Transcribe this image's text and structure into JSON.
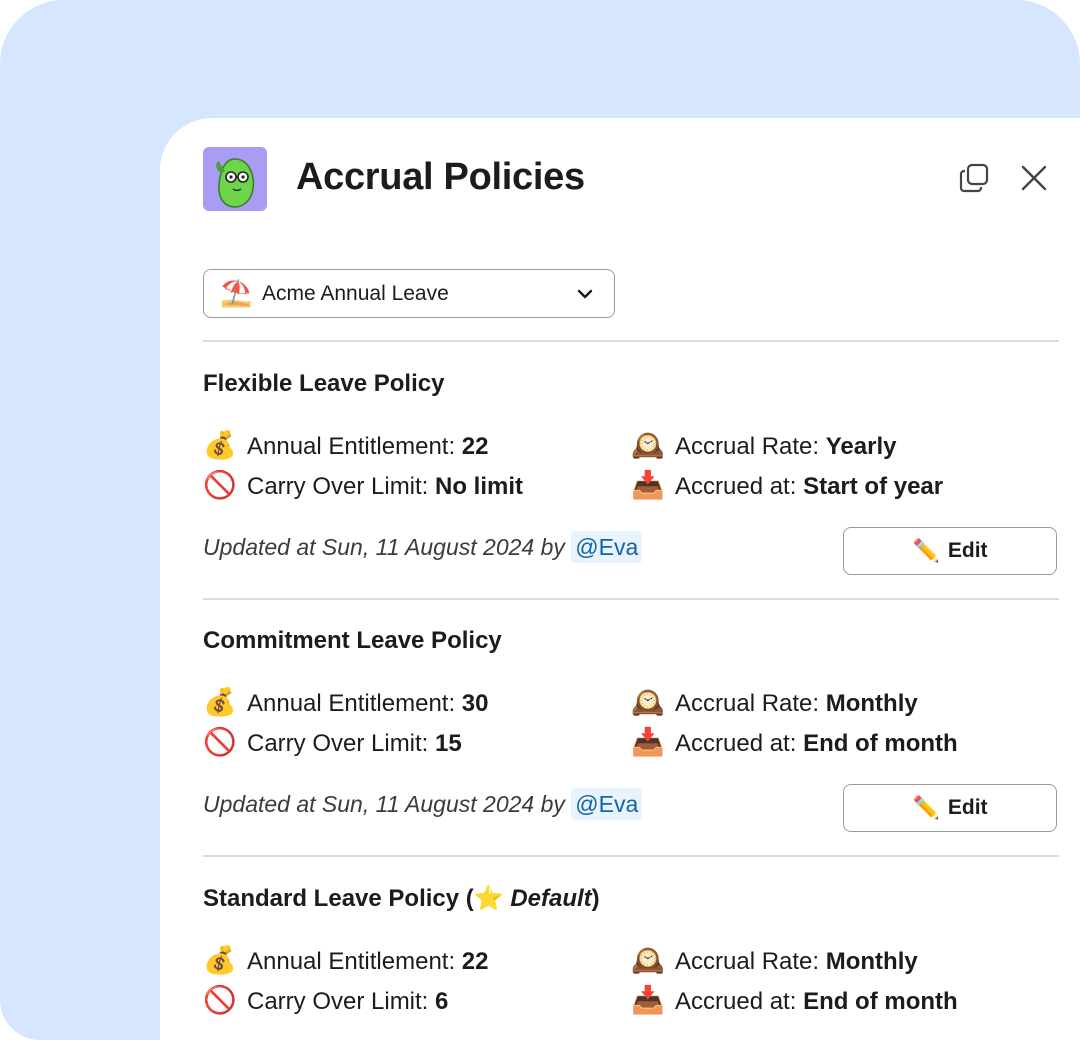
{
  "modal": {
    "title": "Accrual Policies",
    "avatar_icon": "bird-with-glasses-icon",
    "copy_icon": "copy-icon",
    "close_icon": "close-icon"
  },
  "policy_select": {
    "emoji": "⛱️",
    "selected": "Acme Annual Leave"
  },
  "labels": {
    "entitlement": "Annual Entitlement: ",
    "carry": "Carry Over Limit: ",
    "rate": "Accrual Rate: ",
    "accrued": "Accrued at: ",
    "updated_prefix": "Updated at ",
    "by": " by ",
    "edit": "Edit"
  },
  "icons": {
    "money_bag": "💰",
    "no_entry": "🚫",
    "clock": "🕰️",
    "inbox": "📥",
    "pencil": "✏️",
    "star": "⭐"
  },
  "policies": [
    {
      "name": "Flexible Leave Policy",
      "entitlement": "22",
      "carry_over": "No limit",
      "accrual_rate": "Yearly",
      "accrued_at": "Start of year",
      "updated_date": "Sun, 11 August 2024",
      "updated_by": "@Eva"
    },
    {
      "name": "Commitment Leave Policy",
      "entitlement": "30",
      "carry_over": "15",
      "accrual_rate": "Monthly",
      "accrued_at": "End of month",
      "updated_date": "Sun, 11 August 2024",
      "updated_by": "@Eva"
    },
    {
      "name": "Standard Leave Policy (",
      "default_label": "Default",
      "name_close": ")",
      "entitlement": "22",
      "carry_over": "6",
      "accrual_rate": "Monthly",
      "accrued_at": "End of month"
    }
  ],
  "colors": {
    "backdrop": "#d6e6fc",
    "mention": "#1264a3",
    "avatar_bg": "#a99cf4"
  }
}
